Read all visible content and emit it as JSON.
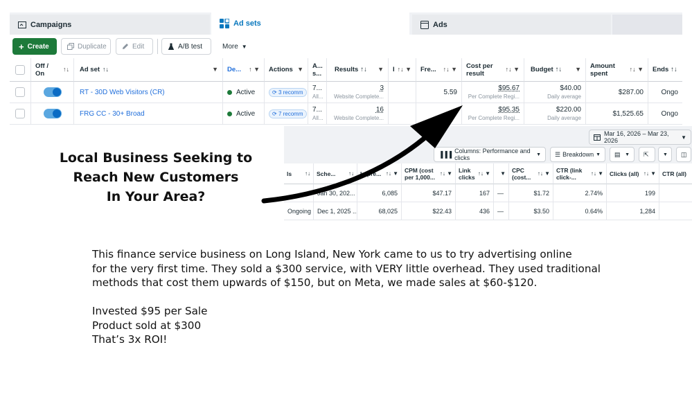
{
  "tabs": [
    {
      "label": "Campaigns",
      "icon": "folder-icon"
    },
    {
      "label": "Ad sets",
      "icon": "grid-icon"
    },
    {
      "label": "Ads",
      "icon": "ad-page-icon"
    }
  ],
  "toolbar": {
    "create": "Create",
    "duplicate": "Duplicate",
    "edit": "Edit",
    "ab_test": "A/B test",
    "more": "More"
  },
  "columns": {
    "off_on": "Off / On",
    "ad_set": "Ad set",
    "delivery": "De...",
    "actions": "Actions",
    "attribution": "A... s...",
    "results": "Results",
    "col_i": "I",
    "frequency": "Fre...",
    "cost_per_result": "Cost per result",
    "budget": "Budget",
    "amount_spent": "Amount spent",
    "ends": "Ends"
  },
  "rows": [
    {
      "name": "RT - 30D Web Visitors (CR)",
      "delivery": "Active",
      "actions": "3 recomm",
      "attribution": "7...",
      "attribution_sub": "All...",
      "results": "3",
      "results_sub": "Website Complete...",
      "frequency": "5.59",
      "cost_per_result": "$95.67",
      "cost_sub": "Per Complete Regi...",
      "budget": "$40.00",
      "budget_sub": "Daily average",
      "amount_spent": "$287.00",
      "ends": "Ongo"
    },
    {
      "name": "FRG CC - 30+ Broad",
      "delivery": "Active",
      "actions": "7 recomm",
      "attribution": "7...",
      "attribution_sub": "All...",
      "results": "16",
      "results_sub": "Website Complete...",
      "frequency": "",
      "cost_per_result": "$95.35",
      "cost_sub": "Per Complete Regi...",
      "budget": "$220.00",
      "budget_sub": "Daily average",
      "amount_spent": "$1,525.65",
      "ends": "Ongo"
    }
  ],
  "lower": {
    "date_range": "Mar 16, 2026 – Mar 23, 2026",
    "columns_btn": "Columns: Performance and clicks",
    "breakdown_btn": "Breakdown",
    "headers": {
      "ends": "ls",
      "schedule": "Sche...",
      "impressions": "Impre...",
      "cpm": "CPM (cost per 1,000...",
      "link_clicks": "Link clicks",
      "dash_col": "",
      "cpc": "CPC (cost...",
      "ctr": "CTR (link click-...",
      "clicks_all": "Clicks (all)",
      "ctr_all": "CTR (all)"
    },
    "rows": [
      {
        "ends": "",
        "schedule": "Jan 30, 202...",
        "impressions": "6,085",
        "cpm": "$47.17",
        "link_clicks": "167",
        "dash": "—",
        "cpc": "$1.72",
        "ctr": "2.74%",
        "clicks_all": "199",
        "ctr_all": ""
      },
      {
        "ends": "Ongoing",
        "schedule": "Dec 1, 2025 ...",
        "impressions": "68,025",
        "cpm": "$22.43",
        "link_clicks": "436",
        "dash": "—",
        "cpc": "$3.50",
        "ctr": "0.64%",
        "clicks_all": "1,284",
        "ctr_all": ""
      }
    ]
  },
  "headline": {
    "line1": "Local Business Seeking to",
    "line2": "Reach New Customers",
    "line3": "In Your Area?"
  },
  "body": {
    "para1_line1": "This finance service business on Long Island, New York came to us to try advertising online",
    "para1_line2": "for the very first time. They sold a $300 service, with VERY little overhead. They used traditional",
    "para1_line3": "methods that cost them upwards of $150, but on Meta, we made sales at $60-$120.",
    "line_invested": "Invested $95 per Sale",
    "line_product": "Product sold at $300",
    "line_roi": "That’s 3x ROI!"
  },
  "colors": {
    "create_green": "#1d7a3a",
    "link_blue": "#216fdb",
    "active_tab": "#0a78be"
  }
}
